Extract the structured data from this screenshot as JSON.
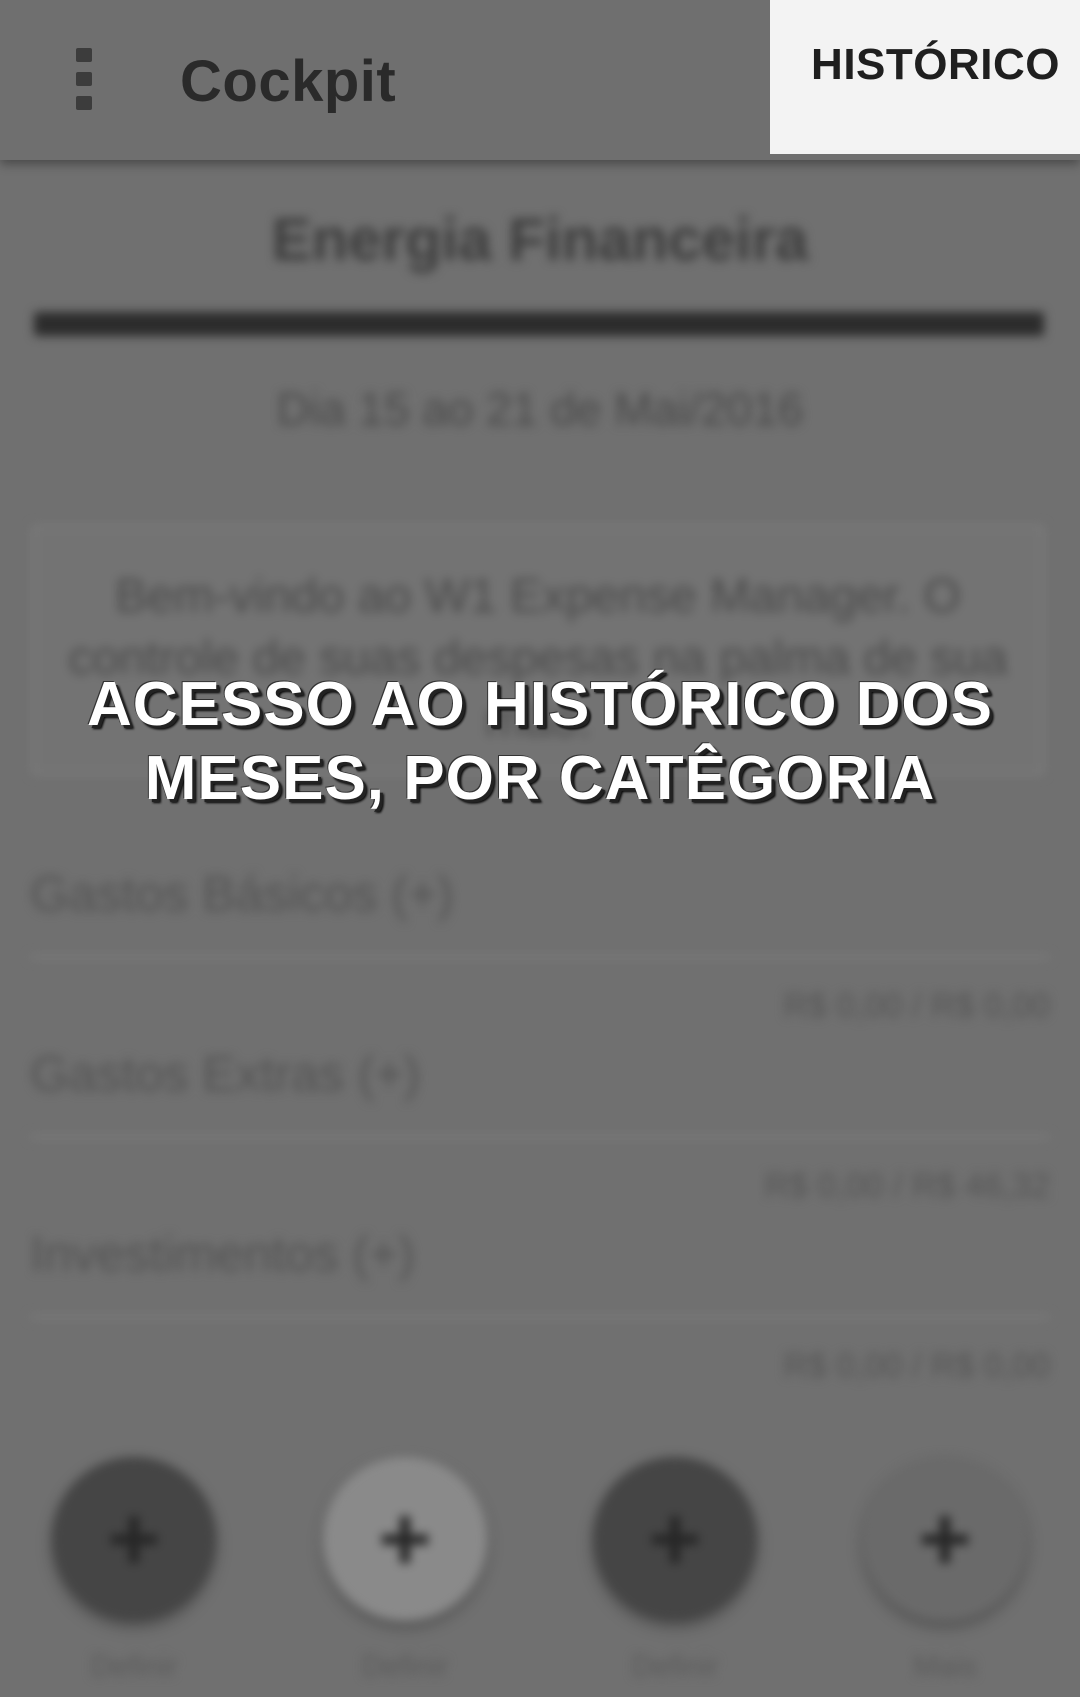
{
  "appbar": {
    "title": "Cockpit",
    "history_label": "HISTÓRICO",
    "menu_icon": "overflow-menu-icon"
  },
  "content": {
    "energy_title": "Energia Financeira",
    "period": "Dia 15 ao 21 de Mai/2016",
    "welcome_message": "Bem-vindo ao W1 Expense Manager. O controle de suas despesas na palma de sua mão."
  },
  "categories": [
    {
      "title": "Gastos Básicos (+)",
      "value": "R$ 0,00 / R$ 0,00"
    },
    {
      "title": "Gastos Extras (+)",
      "value": "R$ 0,00 / R$ 46,32"
    },
    {
      "title": "Investimentos (+)",
      "value": "R$ 0,00 / R$ 0,00"
    }
  ],
  "actions": [
    {
      "icon": "plus-icon",
      "symbol": "+",
      "label": "Definir",
      "color": "#454545"
    },
    {
      "icon": "plus-icon",
      "symbol": "+",
      "label": "Definir",
      "color": "#8a8a8a"
    },
    {
      "icon": "plus-icon",
      "symbol": "+",
      "label": "Definir",
      "color": "#454545"
    },
    {
      "icon": "plus-icon",
      "symbol": "+",
      "label": "Mais",
      "color": "#6a6a6a"
    }
  ],
  "overlay": {
    "line1": "ACESSO AO HISTÓRICO DOS",
    "line2": "MESES, POR CATÊGORIA"
  },
  "colors": {
    "dim_background": "#707070",
    "highlight": "#f3f3f3",
    "caption_text": "#ffffff"
  }
}
